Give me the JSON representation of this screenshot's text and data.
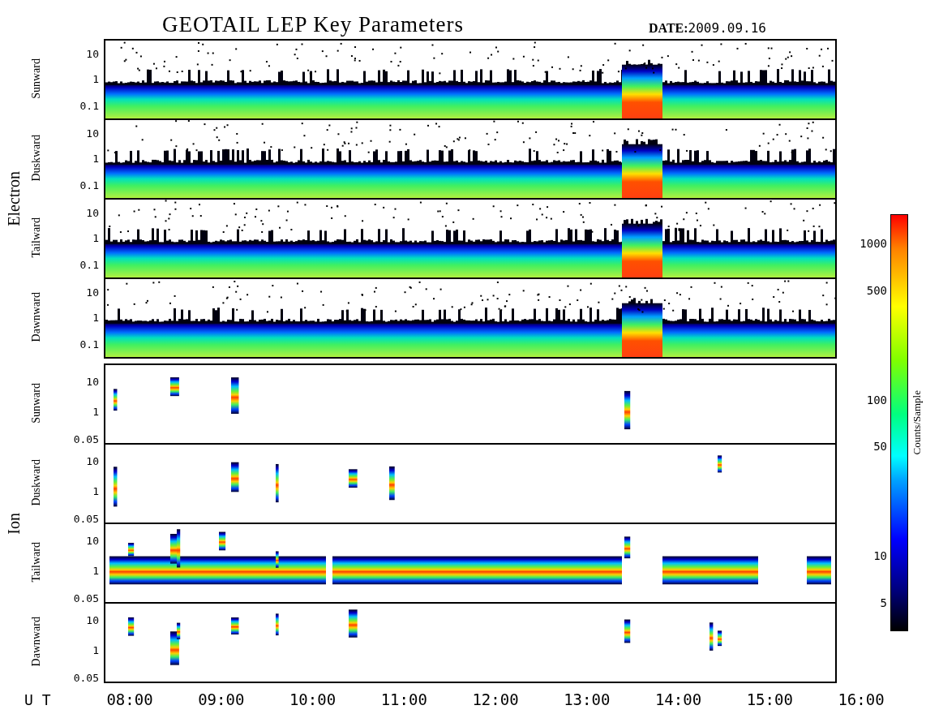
{
  "title": "GEOTAIL LEP Key Parameters",
  "date": "**DATE:**2009.09.16",
  "groups": [
    {
      "label": "Electron",
      "kind": "electron",
      "panels": [
        {
          "label": "Sunward",
          "yticks": [
            "10",
            "1",
            "0.1"
          ]
        },
        {
          "label": "Duskward",
          "yticks": [
            "10",
            "1",
            "0.1"
          ]
        },
        {
          "label": "Tailward",
          "yticks": [
            "10",
            "1",
            "0.1"
          ]
        },
        {
          "label": "Dawnward",
          "yticks": [
            "10",
            "1",
            "0.1"
          ]
        }
      ]
    },
    {
      "label": "Ion",
      "kind": "ion",
      "panels": [
        {
          "label": "Sunward",
          "yticks": [
            "10",
            "1",
            "0.05"
          ]
        },
        {
          "label": "Duskward",
          "yticks": [
            "10",
            "1",
            "0.05"
          ]
        },
        {
          "label": "Tailward",
          "yticks": [
            "10",
            "1",
            "0.05"
          ]
        },
        {
          "label": "Dawnward",
          "yticks": [
            "10",
            "1",
            "0.05"
          ]
        }
      ]
    }
  ],
  "time_axis": {
    "label": "U T",
    "ticks": [
      "08:00",
      "09:00",
      "10:00",
      "11:00",
      "12:00",
      "13:00",
      "14:00",
      "15:00",
      "16:00"
    ]
  },
  "colorbar": {
    "title": "Counts/Sample",
    "ticks": [
      "1000",
      "500",
      "100",
      "50",
      "10",
      "5"
    ]
  }
}
